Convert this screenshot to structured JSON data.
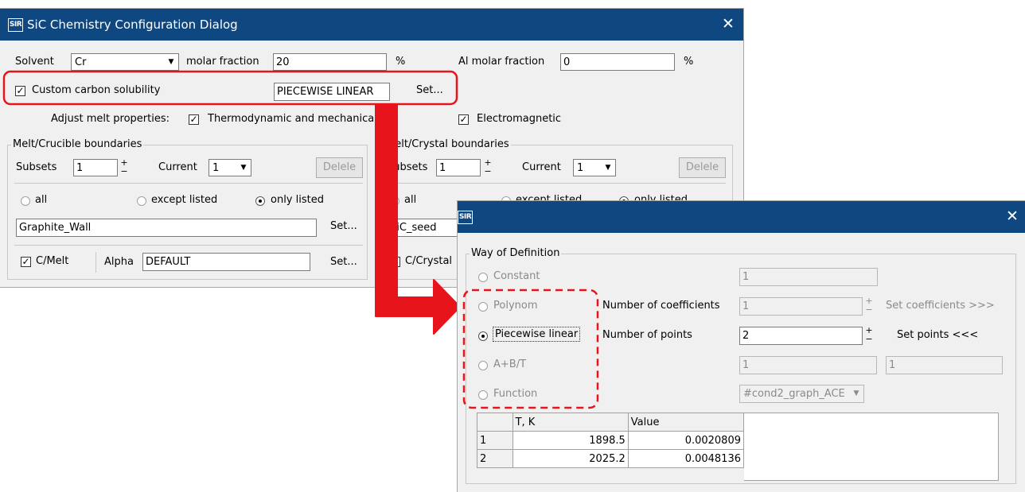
{
  "main_dialog": {
    "title": "SiC Chemistry Configuration Dialog",
    "app_icon": "SIR",
    "close": "✕",
    "solvent_label": "Solvent",
    "solvent_value": "Cr",
    "molar_fraction_label": "molar fraction",
    "molar_fraction_value": "20",
    "percent": "%",
    "al_label": "Al molar fraction",
    "al_value": "0",
    "al_percent": "%",
    "custom_solubility_label": "Custom carbon solubility",
    "custom_solubility_checked": true,
    "solubility_type": "PIECEWISE LINEAR",
    "set_label": "Set...",
    "adjust_label": "Adjust melt properties:",
    "thermo_label": "Thermodynamic and mechanical",
    "em_label": "Electromagnetic",
    "crucible": {
      "title": "Melt/Crucible boundaries",
      "subsets_label": "Subsets",
      "subsets_value": "1",
      "current_label": "Current",
      "current_value": "1",
      "delete_label": "Delele",
      "all_label": "all",
      "except_label": "except listed",
      "only_label": "only listed",
      "list_value": "Graphite_Wall",
      "set_label": "Set...",
      "cmelt_label": "C/Melt",
      "alpha_label": "Alpha",
      "alpha_value": "DEFAULT",
      "set2_label": "Set..."
    },
    "crystal": {
      "title": "Melt/Crystal boundaries",
      "subsets_label": "Subsets",
      "subsets_value": "1",
      "current_label": "Current",
      "current_value": "1",
      "delete_label": "Delele",
      "all_label": "all",
      "except_label": "except listed",
      "only_label": "only listed",
      "list_value": "SiC_seed",
      "ccrystal_label": "C/Crystal"
    }
  },
  "sub_dialog": {
    "app_icon": "SIR",
    "close": "✕",
    "group_title": "Way of Definition",
    "constant_label": "Constant",
    "constant_value": "1",
    "polynom_label": "Polynom",
    "coeff_label": "Number of coefficients",
    "coeff_value": "1",
    "set_coeff_label": "Set coefficients >>>",
    "piecewise_label": "Piecewise linear",
    "points_label": "Number of points",
    "points_value": "2",
    "set_points_label": "Set points <<<",
    "abt_label": "A+B/T",
    "abt_a_value": "1",
    "abt_b_value": "1",
    "function_label": "Function",
    "function_value": "#cond2_graph_ACE",
    "table": {
      "columns": [
        "T, K",
        "Value"
      ],
      "rows": [
        {
          "index": "1",
          "t": "1898.5",
          "value": "0.0020809"
        },
        {
          "index": "2",
          "t": "2025.2",
          "value": "0.0048136"
        }
      ]
    }
  },
  "colors": {
    "title_bar": "#0f4780",
    "highlight": "#e8141b",
    "dialog_bg": "#f0f0f0"
  }
}
